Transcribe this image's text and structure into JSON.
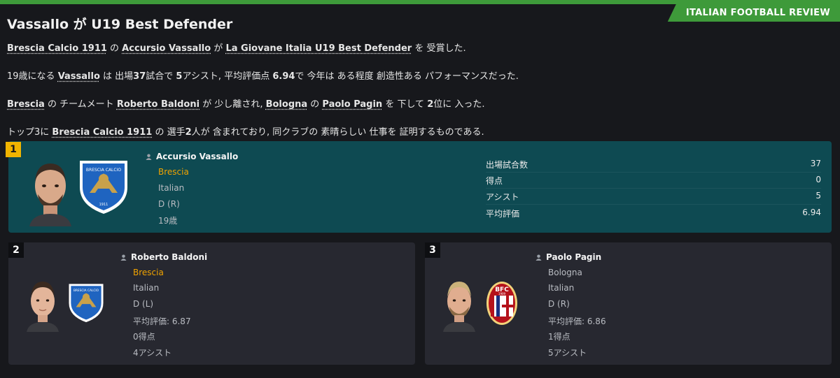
{
  "header": {
    "tag": "ITALIAN FOOTBALL REVIEW",
    "headline": "Vassallo が U19 Best Defender"
  },
  "article": {
    "p1": {
      "club": "Brescia Calcio 1911",
      "t1": " の ",
      "player": "Accursio Vassallo",
      "t2": " が ",
      "award": "La Giovane Italia U19 Best Defender",
      "t3": " を 受賞した."
    },
    "p2": {
      "t1": "19歳になる ",
      "player": "Vassallo",
      "t2": " は 出場",
      "apps": "37",
      "t3": "試合で ",
      "assists": "5",
      "t4": "アシスト, 平均評価点 ",
      "rating": "6.94",
      "t5": "で 今年は ある程度 創造性ある パフォーマンスだった."
    },
    "p3": {
      "club": "Brescia",
      "t1": " の チームメート ",
      "player2": "Roberto Baldoni",
      "t2": " が 少し離され, ",
      "club2": "Bologna",
      "t3": " の ",
      "player3": "Paolo Pagin",
      "t4": " を 下して ",
      "place": "2",
      "t5": "位に 入った."
    },
    "p4": {
      "t1": "トップ3に ",
      "club": "Brescia Calcio 1911",
      "t2": " の 選手",
      "count": "2",
      "t3": "人が 含まれており, 同クラブの 素晴らしい 仕事を 証明するものである."
    }
  },
  "winner": {
    "rank": "1",
    "name": "Accursio Vassallo",
    "club": "Brescia",
    "nationality": "Italian",
    "position": "D (R)",
    "age": "19歳",
    "crest_text": "BRESCIA CALCIO",
    "crest_year": "1911",
    "stats": [
      {
        "label": "出場試合数",
        "value": "37"
      },
      {
        "label": "得点",
        "value": "0"
      },
      {
        "label": "アシスト",
        "value": "5"
      },
      {
        "label": "平均評価",
        "value": "6.94"
      }
    ]
  },
  "runners": [
    {
      "rank": "2",
      "name": "Roberto Baldoni",
      "club": "Brescia",
      "nationality": "Italian",
      "position": "D (L)",
      "rating": "平均評価: 6.87",
      "goals": "0得点",
      "assists": "4アシスト"
    },
    {
      "rank": "3",
      "name": "Paolo Pagin",
      "club": "Bologna",
      "nationality": "Italian",
      "position": "D (R)",
      "rating": "平均評価: 6.86",
      "goals": "1得点",
      "assists": "5アシスト",
      "crest_text": "BFC",
      "crest_year": "1909"
    }
  ],
  "colors": {
    "accent_green": "#3e9a3a",
    "winner_bg": "#0e4a52",
    "card_bg": "#272830",
    "club_highlight": "#f0a300",
    "rank_gold": "#f0b400"
  }
}
